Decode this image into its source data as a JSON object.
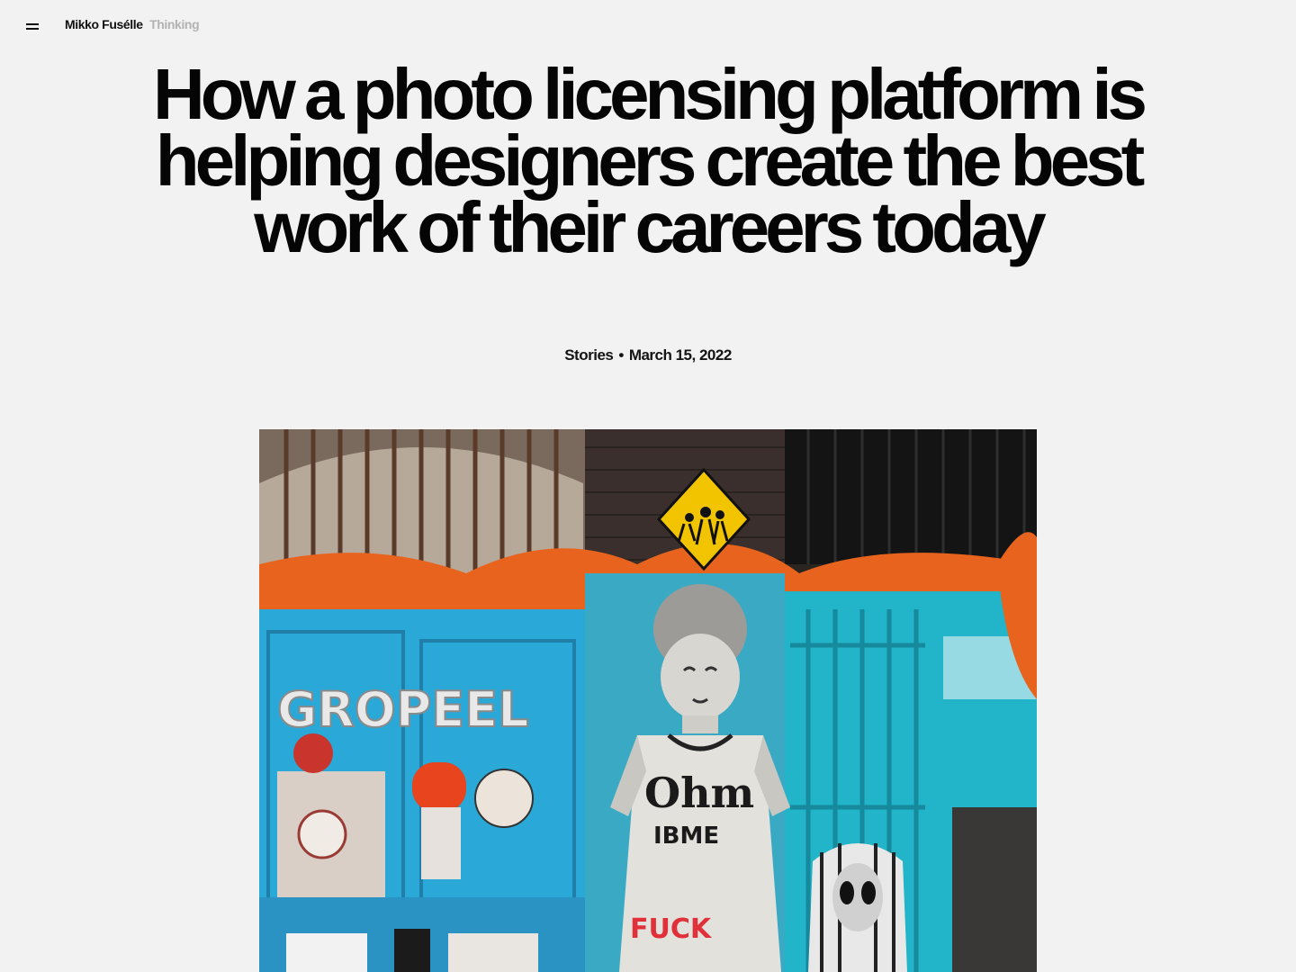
{
  "header": {
    "site_name": "Mikko Fusélle",
    "section": "Thinking",
    "menu_icon": "hamburger-menu-icon"
  },
  "article": {
    "title": "How a photo licensing platform is helping designers create the best work of their careers today",
    "category": "Stories",
    "separator": "•",
    "date": "March 15, 2022"
  },
  "hero_image": {
    "description_icon": "street-art-photo",
    "wall_text": [
      "Ohm",
      "IBME",
      "FUCK",
      "GROPEEL"
    ]
  },
  "colors": {
    "background": "#f2f2f2",
    "text": "#0a0a0a",
    "muted": "#b3b3b3",
    "accent_turquoise": "#2aa8d8",
    "accent_orange": "#e8641e",
    "sign_yellow": "#f2c400"
  }
}
